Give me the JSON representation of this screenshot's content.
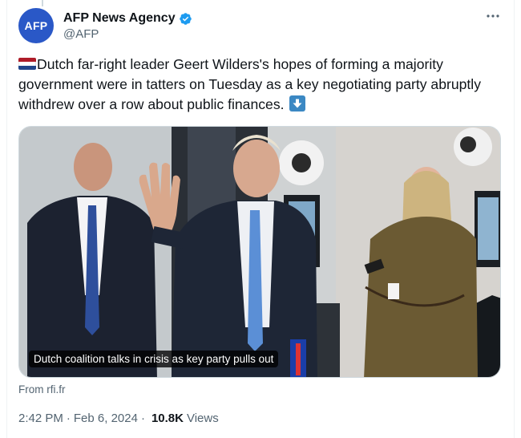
{
  "author": {
    "display_name": "AFP News Agency",
    "handle": "@AFP",
    "avatar_text": "AFP",
    "verified": true,
    "avatar_color": "#2a58c7",
    "verified_color": "#1d9bf0"
  },
  "tweet": {
    "text": "Dutch far-right leader Geert Wilders's hopes of forming a majority government were in tatters on Tuesday as a key negotiating party abruptly withdrew over a row about public finances.",
    "leading_emoji": "flag-netherlands",
    "trailing_emoji": "down-arrow-emoji"
  },
  "media": {
    "caption": "Dutch coalition talks in crisis as key party pulls out",
    "source": "From rfi.fr"
  },
  "meta": {
    "time": "2:42 PM",
    "date": "Feb 6, 2024",
    "separator": "·",
    "views_count": "10.8K",
    "views_label": "Views"
  },
  "colors": {
    "text_primary": "#0f1419",
    "text_secondary": "#536471",
    "border": "#cfd9de"
  }
}
